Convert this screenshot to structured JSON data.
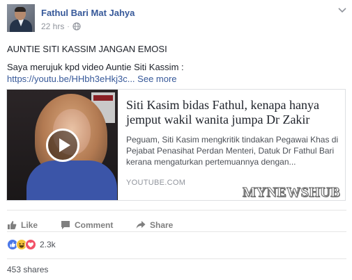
{
  "post": {
    "author": "Fathul Bari Mat Jahya",
    "time": "22 hrs",
    "separator": "·",
    "title": "AUNTIE SITI KASSIM JANGAN EMOSI",
    "body_text": "Saya merujuk kpd video Auntie Siti Kassim :",
    "link_text": "https://youtu.be/HHbh3eHkj3c...",
    "see_more": "See more"
  },
  "link_card": {
    "headline": "Siti Kasim bidas Fathul, kenapa hanya jemput wakil wanita jumpa Dr Zakir",
    "description": "Peguam, Siti Kasim mengkritik tindakan Pegawai Khas di Pejabat Penasihat Perdan Menteri, Datuk Dr Fathul Bari kerana mengaturkan pertemuannya dengan...",
    "source": "YOUTUBE.COM",
    "watermark": "MYNEWSHUB"
  },
  "actions": {
    "like": "Like",
    "comment": "Comment",
    "share": "Share"
  },
  "reactions": {
    "count": "2.3k",
    "types": [
      "like-icon",
      "haha-icon",
      "love-icon"
    ]
  },
  "shares": "453 shares",
  "colors": {
    "link": "#365899",
    "muted": "#90949c",
    "text": "#1d2129",
    "like_blue": "#4a77e8",
    "haha_yellow": "#f5c33b",
    "love_red": "#f25268"
  }
}
